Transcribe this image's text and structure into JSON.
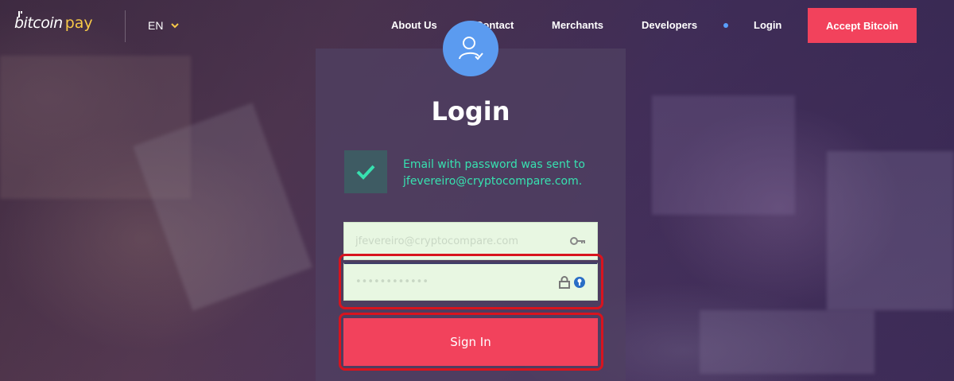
{
  "header": {
    "logo_part1": "bitcoin",
    "logo_part2": "pay",
    "language": "EN",
    "nav": {
      "about": "About Us",
      "contact": "Contact",
      "merchants": "Merchants",
      "developers": "Developers",
      "login": "Login"
    },
    "cta": "Accept Bitcoin"
  },
  "login": {
    "title": "Login",
    "message": "Email with password was sent to jfevereiro@cryptocompare.com.",
    "email_value": "jfevereiro@cryptocompare.com",
    "password_value": "••••••••••••",
    "submit_label": "Sign In"
  },
  "colors": {
    "accent": "#f2425c",
    "success_text": "#37e1b0",
    "avatar_bg": "#5b9bf0",
    "logo_accent": "#f7c948",
    "field_bg": "#e8f7e2",
    "highlight": "#d8141e"
  },
  "icons": {
    "avatar": "user-check-icon",
    "check": "checkmark-icon",
    "key": "key-icon",
    "lock": "lock-icon",
    "password_manager": "password-manager-icon",
    "chevron": "chevron-down-icon"
  }
}
